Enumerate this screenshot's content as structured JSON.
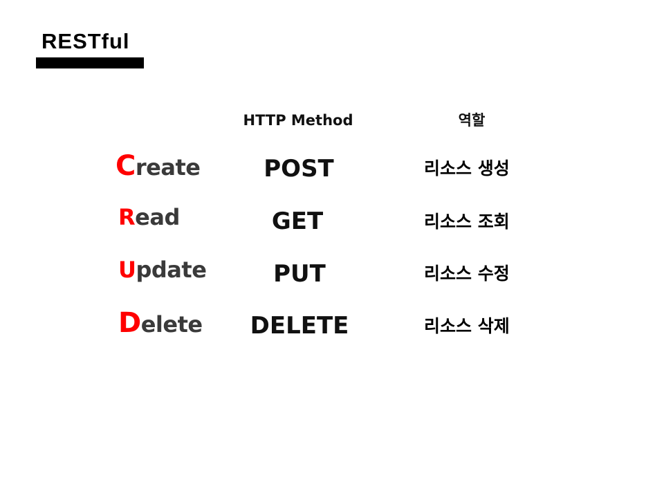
{
  "title": "RESTful",
  "headers": {
    "method": "HTTP Method",
    "role": "역할"
  },
  "rows": [
    {
      "initial": "C",
      "rest": "reate",
      "method": "POST",
      "role": "리소스 생성"
    },
    {
      "initial": "R",
      "rest": "ead",
      "method": "GET",
      "role": "리소스 조회"
    },
    {
      "initial": "U",
      "rest": "pdate",
      "method": "PUT",
      "role": "리소스 수정"
    },
    {
      "initial": "D",
      "rest": "elete",
      "method": "DELETE",
      "role": "리소스 삭제"
    }
  ],
  "colors": {
    "accent": "#ff0000",
    "word": "#3a3a3a",
    "text": "#000000",
    "background": "#ffffff"
  }
}
